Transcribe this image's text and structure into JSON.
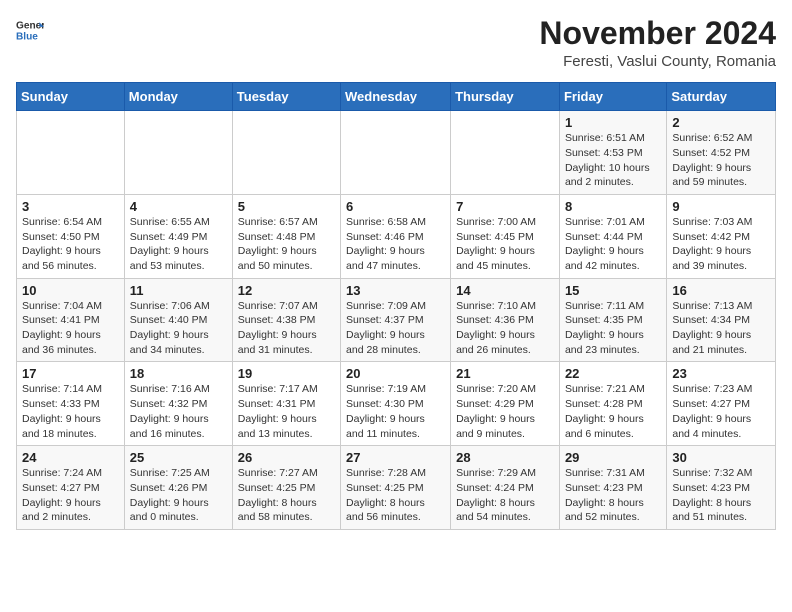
{
  "header": {
    "logo_general": "General",
    "logo_blue": "Blue",
    "month_title": "November 2024",
    "location": "Feresti, Vaslui County, Romania"
  },
  "weekdays": [
    "Sunday",
    "Monday",
    "Tuesday",
    "Wednesday",
    "Thursday",
    "Friday",
    "Saturday"
  ],
  "weeks": [
    [
      {
        "day": "",
        "info": ""
      },
      {
        "day": "",
        "info": ""
      },
      {
        "day": "",
        "info": ""
      },
      {
        "day": "",
        "info": ""
      },
      {
        "day": "",
        "info": ""
      },
      {
        "day": "1",
        "info": "Sunrise: 6:51 AM\nSunset: 4:53 PM\nDaylight: 10 hours\nand 2 minutes."
      },
      {
        "day": "2",
        "info": "Sunrise: 6:52 AM\nSunset: 4:52 PM\nDaylight: 9 hours\nand 59 minutes."
      }
    ],
    [
      {
        "day": "3",
        "info": "Sunrise: 6:54 AM\nSunset: 4:50 PM\nDaylight: 9 hours\nand 56 minutes."
      },
      {
        "day": "4",
        "info": "Sunrise: 6:55 AM\nSunset: 4:49 PM\nDaylight: 9 hours\nand 53 minutes."
      },
      {
        "day": "5",
        "info": "Sunrise: 6:57 AM\nSunset: 4:48 PM\nDaylight: 9 hours\nand 50 minutes."
      },
      {
        "day": "6",
        "info": "Sunrise: 6:58 AM\nSunset: 4:46 PM\nDaylight: 9 hours\nand 47 minutes."
      },
      {
        "day": "7",
        "info": "Sunrise: 7:00 AM\nSunset: 4:45 PM\nDaylight: 9 hours\nand 45 minutes."
      },
      {
        "day": "8",
        "info": "Sunrise: 7:01 AM\nSunset: 4:44 PM\nDaylight: 9 hours\nand 42 minutes."
      },
      {
        "day": "9",
        "info": "Sunrise: 7:03 AM\nSunset: 4:42 PM\nDaylight: 9 hours\nand 39 minutes."
      }
    ],
    [
      {
        "day": "10",
        "info": "Sunrise: 7:04 AM\nSunset: 4:41 PM\nDaylight: 9 hours\nand 36 minutes."
      },
      {
        "day": "11",
        "info": "Sunrise: 7:06 AM\nSunset: 4:40 PM\nDaylight: 9 hours\nand 34 minutes."
      },
      {
        "day": "12",
        "info": "Sunrise: 7:07 AM\nSunset: 4:38 PM\nDaylight: 9 hours\nand 31 minutes."
      },
      {
        "day": "13",
        "info": "Sunrise: 7:09 AM\nSunset: 4:37 PM\nDaylight: 9 hours\nand 28 minutes."
      },
      {
        "day": "14",
        "info": "Sunrise: 7:10 AM\nSunset: 4:36 PM\nDaylight: 9 hours\nand 26 minutes."
      },
      {
        "day": "15",
        "info": "Sunrise: 7:11 AM\nSunset: 4:35 PM\nDaylight: 9 hours\nand 23 minutes."
      },
      {
        "day": "16",
        "info": "Sunrise: 7:13 AM\nSunset: 4:34 PM\nDaylight: 9 hours\nand 21 minutes."
      }
    ],
    [
      {
        "day": "17",
        "info": "Sunrise: 7:14 AM\nSunset: 4:33 PM\nDaylight: 9 hours\nand 18 minutes."
      },
      {
        "day": "18",
        "info": "Sunrise: 7:16 AM\nSunset: 4:32 PM\nDaylight: 9 hours\nand 16 minutes."
      },
      {
        "day": "19",
        "info": "Sunrise: 7:17 AM\nSunset: 4:31 PM\nDaylight: 9 hours\nand 13 minutes."
      },
      {
        "day": "20",
        "info": "Sunrise: 7:19 AM\nSunset: 4:30 PM\nDaylight: 9 hours\nand 11 minutes."
      },
      {
        "day": "21",
        "info": "Sunrise: 7:20 AM\nSunset: 4:29 PM\nDaylight: 9 hours\nand 9 minutes."
      },
      {
        "day": "22",
        "info": "Sunrise: 7:21 AM\nSunset: 4:28 PM\nDaylight: 9 hours\nand 6 minutes."
      },
      {
        "day": "23",
        "info": "Sunrise: 7:23 AM\nSunset: 4:27 PM\nDaylight: 9 hours\nand 4 minutes."
      }
    ],
    [
      {
        "day": "24",
        "info": "Sunrise: 7:24 AM\nSunset: 4:27 PM\nDaylight: 9 hours\nand 2 minutes."
      },
      {
        "day": "25",
        "info": "Sunrise: 7:25 AM\nSunset: 4:26 PM\nDaylight: 9 hours\nand 0 minutes."
      },
      {
        "day": "26",
        "info": "Sunrise: 7:27 AM\nSunset: 4:25 PM\nDaylight: 8 hours\nand 58 minutes."
      },
      {
        "day": "27",
        "info": "Sunrise: 7:28 AM\nSunset: 4:25 PM\nDaylight: 8 hours\nand 56 minutes."
      },
      {
        "day": "28",
        "info": "Sunrise: 7:29 AM\nSunset: 4:24 PM\nDaylight: 8 hours\nand 54 minutes."
      },
      {
        "day": "29",
        "info": "Sunrise: 7:31 AM\nSunset: 4:23 PM\nDaylight: 8 hours\nand 52 minutes."
      },
      {
        "day": "30",
        "info": "Sunrise: 7:32 AM\nSunset: 4:23 PM\nDaylight: 8 hours\nand 51 minutes."
      }
    ]
  ]
}
